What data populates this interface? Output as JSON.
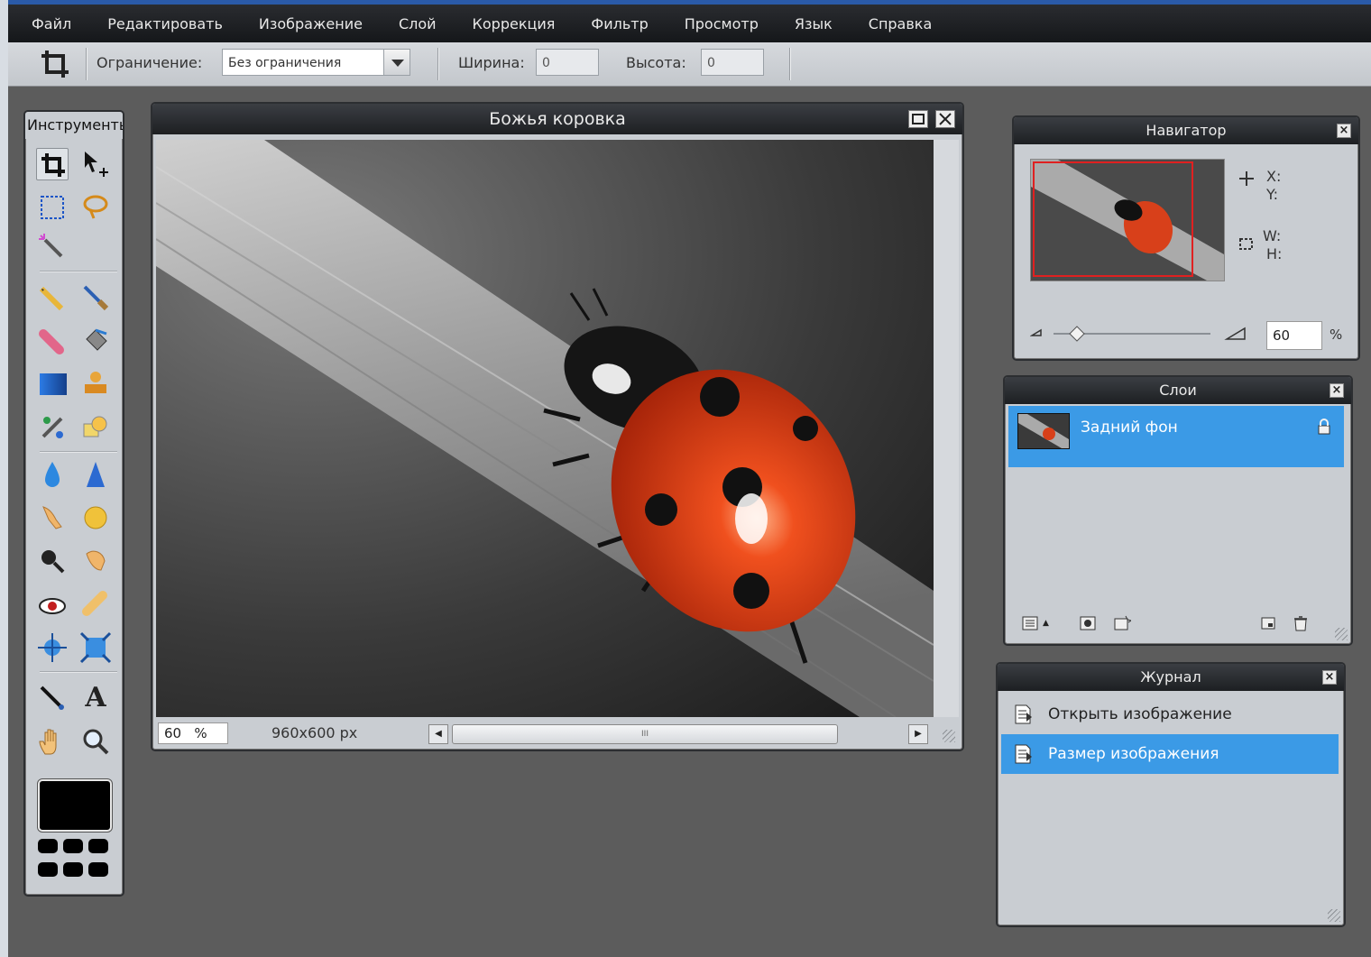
{
  "menu": [
    "Файл",
    "Редактировать",
    "Изображение",
    "Слой",
    "Коррекция",
    "Фильтр",
    "Просмотр",
    "Язык",
    "Справка"
  ],
  "options": {
    "constraint_label": "Ограничение:",
    "constraint_value": "Без ограничения",
    "width_label": "Ширина:",
    "width_value": "0",
    "height_label": "Высота:",
    "height_value": "0"
  },
  "tools": {
    "title": "Инструменты",
    "icons": [
      "crop-icon",
      "move-icon",
      "marquee-icon",
      "lasso-icon",
      "magic-wand-icon",
      "pencil-icon",
      "brush-icon",
      "eraser-icon",
      "paint-bucket-icon",
      "gradient-icon",
      "clone-stamp-icon",
      "color-replace-icon",
      "drawing-icon",
      "blur-icon",
      "sharpen-icon",
      "smudge-icon",
      "sponge-icon",
      "dodge-icon",
      "burn-icon",
      "red-eye-icon",
      "spot-heal-icon",
      "bloat-icon",
      "pinch-icon",
      "color-picker-icon",
      "type-icon",
      "hand-icon",
      "zoom-icon"
    ]
  },
  "image_window": {
    "title": "Божья коровка",
    "zoom": "60",
    "zoom_unit": "%",
    "dimensions": "960x600 px",
    "scroll_grip": "III"
  },
  "navigator": {
    "title": "Навигатор",
    "x_label": "X:",
    "y_label": "Y:",
    "w_label": "W:",
    "h_label": "H:",
    "zoom": "60",
    "zoom_unit": "%"
  },
  "layers": {
    "title": "Слои",
    "items": [
      {
        "name": "Задний фон",
        "locked": true
      }
    ]
  },
  "history": {
    "title": "Журнал",
    "items": [
      {
        "label": "Открыть изображение",
        "selected": false
      },
      {
        "label": "Размер изображения",
        "selected": true
      }
    ]
  },
  "colors": {
    "accent": "#3b9ae6",
    "foreground": "#000000",
    "titlebar": "#1d1f22",
    "panel": "#c9cdd2"
  }
}
